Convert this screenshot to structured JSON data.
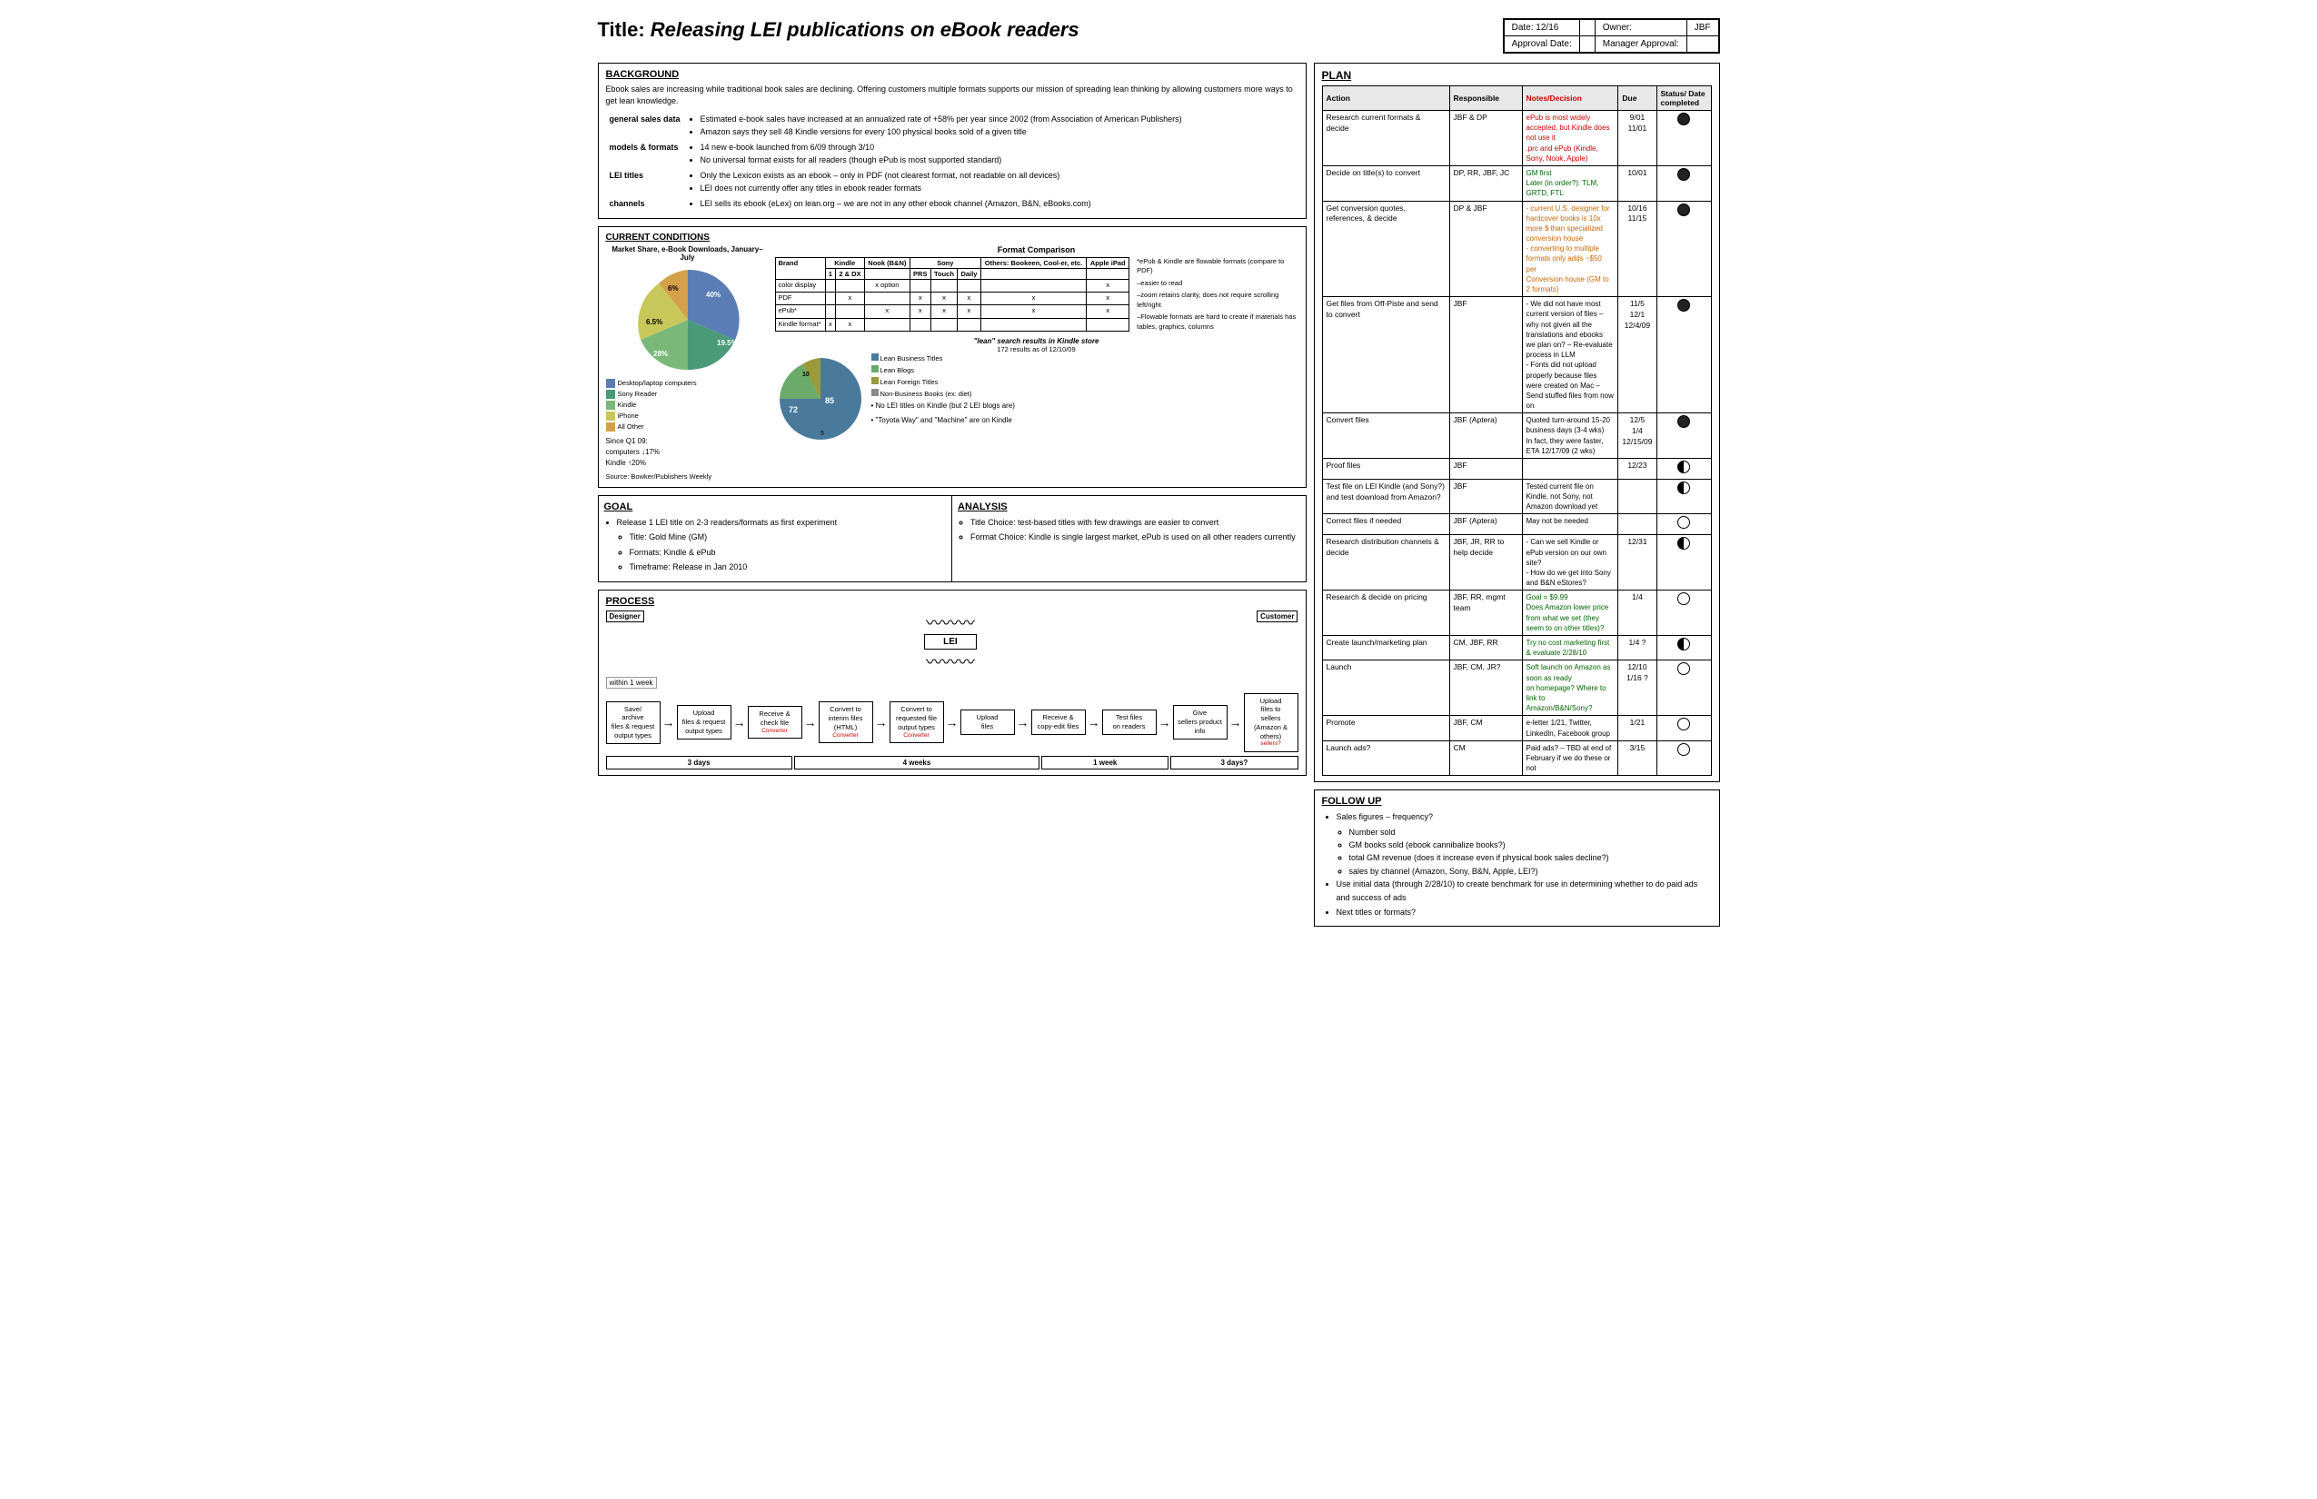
{
  "header": {
    "title": "Releasing LEI publications on eBook readers",
    "date_label": "Date: 12/16",
    "date_value": "",
    "owner_label": "Owner:",
    "owner_value": "JBF",
    "approval_date_label": "Approval Date:",
    "manager_approval_label": "Manager Approval:"
  },
  "background": {
    "title": "BACKGROUND",
    "intro": "Ebook sales are increasing while traditional book sales are declining. Offering customers multiple formats supports our mission of spreading lean thinking by allowing customers more ways to get lean knowledge.",
    "rows": [
      {
        "label": "general sales data",
        "items": [
          "Estimated e-book sales have increased at an annualized rate of +58% per year since 2002 (from Association of American Publishers)",
          "Amazon says they sell 48 Kindle versions for every 100 physical books sold of a given title"
        ]
      },
      {
        "label": "models & formats",
        "items": [
          "14 new e-book launched from 6/09 through 3/10",
          "No universal format exists for all readers (though ePub is most supported standard)"
        ]
      },
      {
        "label": "LEI titles",
        "items": [
          "Only the Lexicon exists as an ebook – only in PDF (not clearest format, not readable on all devices)",
          "LEI does not currently offer any titles in ebook reader formats"
        ]
      },
      {
        "label": "channels",
        "items": [
          "LEI sells its ebook (eLex) on lean.org – we are not in any other ebook channel (Amazon, B&N, eBooks.com)"
        ]
      }
    ]
  },
  "current_conditions": {
    "title": "CURRENT CONDITIONS",
    "chart_title": "Market Share, e-Book Downloads, January–July",
    "legend": [
      "Desktop/laptop computers",
      "Sony Reader",
      "Kindle",
      "iPhone",
      "All Other"
    ],
    "since_q1": {
      "title": "Since Q1 09:",
      "computers": "computers  ↓17%",
      "kindle": "Kindle        ↑20%",
      "source": "Source: Bowker/Publishers Weekly"
    },
    "format_comparison": {
      "title": "Format Comparison",
      "note1": "*ePub & Kindle are flowable formats (compare to PDF)",
      "note2": "–easier to read",
      "note3": "–zoom retains clarity, does not require scrolling left/right",
      "note4": "–Flowable formats are hard to create if materials has tables, graphics, columns"
    },
    "kindle_store": {
      "title": "\"lean\" search results in Kindle store",
      "subtitle": "172 results as of 12/10/09",
      "legend": [
        "Lean Business Titles",
        "Lean Blogs",
        "Lean Foreign Titles",
        "Non-Business Books (ex: diet)"
      ],
      "bullet1": "• No LEI titles on Kindle (but 2 LEI blogs are)",
      "bullet2": "• \"Toyota Way\" and \"Machine\" are on Kindle"
    }
  },
  "goal": {
    "title": "GOAL",
    "items": [
      "Release 1 LEI title on 2-3 readers/formats as first experiment"
    ],
    "subitems": [
      "Title: Gold Mine (GM)",
      "Formats: Kindle & ePub",
      "Timeframe: Release in Jan 2010"
    ]
  },
  "analysis": {
    "title": "ANALYSIS",
    "items": [
      "Title Choice: test-based titles with few drawings are easier to convert",
      "Format Choice: Kindle is single largest market, ePub is used on all other readers currently"
    ]
  },
  "process": {
    "title": "PROCESS",
    "designer_label": "Designer",
    "lei_label": "LEI",
    "customer_label": "Customer",
    "within_week": "within 1 week",
    "steps": [
      {
        "line1": "Save/",
        "line2": "archive",
        "line3": "files & request output types"
      },
      {
        "line1": "Upload",
        "line2": "files & request output types"
      },
      {
        "line1": "Receive &",
        "line2": "check file",
        "converter": "Converter"
      },
      {
        "line1": "Convert to",
        "line2": "interim files (HTML)",
        "converter": "Converter"
      },
      {
        "line1": "Convert to",
        "line2": "requested file output types",
        "converter": "Converter"
      },
      {
        "line1": "Upload",
        "line2": "files",
        "converter": ""
      },
      {
        "line1": "Receive &",
        "line2": "copy-edit files"
      },
      {
        "line1": "Test files",
        "line2": "on readers"
      },
      {
        "line1": "Give",
        "line2": "sellers product info"
      },
      {
        "line1": "Upload",
        "line2": "files to",
        "line3": "sellers (Amazon & others)",
        "note": "sellers?"
      }
    ],
    "timing": [
      "3 days",
      "4 weeks",
      "1 week",
      "3 days?"
    ]
  },
  "plan": {
    "title": "PLAN",
    "headers": [
      "Action",
      "Responsible",
      "Notes/Decision",
      "Due",
      "Status/ Date completed"
    ],
    "rows": [
      {
        "action": "Research current formats & decide",
        "responsible": "JBF & DP",
        "notes": "ePub is most widely accepted, but Kindle does not use it\n.prc and ePub (Kindle, Sony, Nook, Apple)",
        "notes_color": "red",
        "due": "9/01\n11/01",
        "status": "filled"
      },
      {
        "action": "Decide on title(s) to convert",
        "responsible": "DP, RR, JBF, JC",
        "notes": "GM first\nLater (in order?): TLM, GRTD, FTL",
        "notes_color": "green",
        "due": "10/01",
        "status": "filled"
      },
      {
        "action": "Get conversion quotes, references, & decide",
        "responsible": "DP & JBF",
        "notes": "- current U.S. designer for hardcover books is 10x more $ than specialized conversion house\n- converting to multiple formats only adds ~$50 per\nConversion house (GM to 2 formats)",
        "notes_color": "orange",
        "due": "10/16\n11/15",
        "status": "filled"
      },
      {
        "action": "Get files from Off-Piste and send to convert",
        "responsible": "JBF",
        "notes": "- We did not have most current version of files – why not given all the translations and ebooks we plan on? – Re-evaluate process in LLM\n- Fonts did not upload properly because files were created on Mac – Send stuffed files from now on",
        "notes_color": "",
        "due": "11/5\n12/1",
        "status": "filled",
        "due2": "12/4/09"
      },
      {
        "action": "Convert files",
        "responsible": "JBF (Aptera)",
        "notes": "Quoted turn-around 15-20 business days (3-4 wks)\nIn fact, they were faster, ETA 12/17/09 (2 wks)",
        "notes_color": "",
        "due": "12/5\n1/4",
        "status": "filled",
        "due2": "12/15/09"
      },
      {
        "action": "Proof files",
        "responsible": "JBF",
        "notes": "",
        "due": "12/23",
        "status": "half"
      },
      {
        "action": "Test file on LEI Kindle (and Sony?) and test download from Amazon?",
        "responsible": "JBF",
        "notes": "Tested current file on Kindle, not Sony, not Amazon download yet",
        "due": "",
        "status": "half"
      },
      {
        "action": "Correct files if needed",
        "responsible": "JBF (Aptera)",
        "notes": "May not be needed",
        "due": "",
        "status": "empty"
      },
      {
        "action": "Research distribution channels & decide",
        "responsible": "JBF, JR, RR to help decide",
        "notes": "- Can we sell Kindle or ePub version on our own site?\n- How do we get into Sony and B&N eStores?",
        "due": "12/31",
        "status": "half"
      },
      {
        "action": "Research & decide on pricing",
        "responsible": "JBF, RR, mgmt team",
        "notes": "Goal = $9.99\nDoes Amazon lower price from what we set (they seem to on other titles)?",
        "notes_color": "green",
        "due": "1/4",
        "status": "empty"
      },
      {
        "action": "Create launch/marketing plan",
        "responsible": "CM, JBF, RR",
        "notes": "Try no cost marketing first & evaluate 2/28/10",
        "notes_color": "green",
        "due": "1/4 ?",
        "status": "half"
      },
      {
        "action": "Launch",
        "responsible": "JBF, CM, JR?",
        "notes": "Soft launch on Amazon as soon as ready\non homepage? Where to link to\nAmazon/B&N/Sony?",
        "notes_color": "green",
        "due": "12/10\n1/16 ?",
        "status": "empty"
      },
      {
        "action": "Promote",
        "responsible": "JBF, CM",
        "notes": "e-letter 1/21, Twitter, LinkedIn, Facebook group",
        "due": "1/21",
        "status": "empty"
      },
      {
        "action": "Launch ads?",
        "responsible": "CM",
        "notes": "Paid ads? – TBD at end of February if we do these or not",
        "due": "3/15",
        "status": "empty"
      }
    ]
  },
  "followup": {
    "title": "FOLLOW UP",
    "items": [
      {
        "text": "Sales figures – frequency?",
        "subitems": [
          "Number sold",
          "GM books sold (ebook cannibalize books?)",
          "total GM revenue (does it increase even if physical book sales decline?)",
          "sales by channel (Amazon, Sony, B&N, Apple, LEI?)"
        ]
      },
      {
        "text": "Use initial data (through 2/28/10) to create benchmark for use in determining whether to do paid ads and success of ads"
      },
      {
        "text": "Next titles or formats?"
      }
    ]
  }
}
